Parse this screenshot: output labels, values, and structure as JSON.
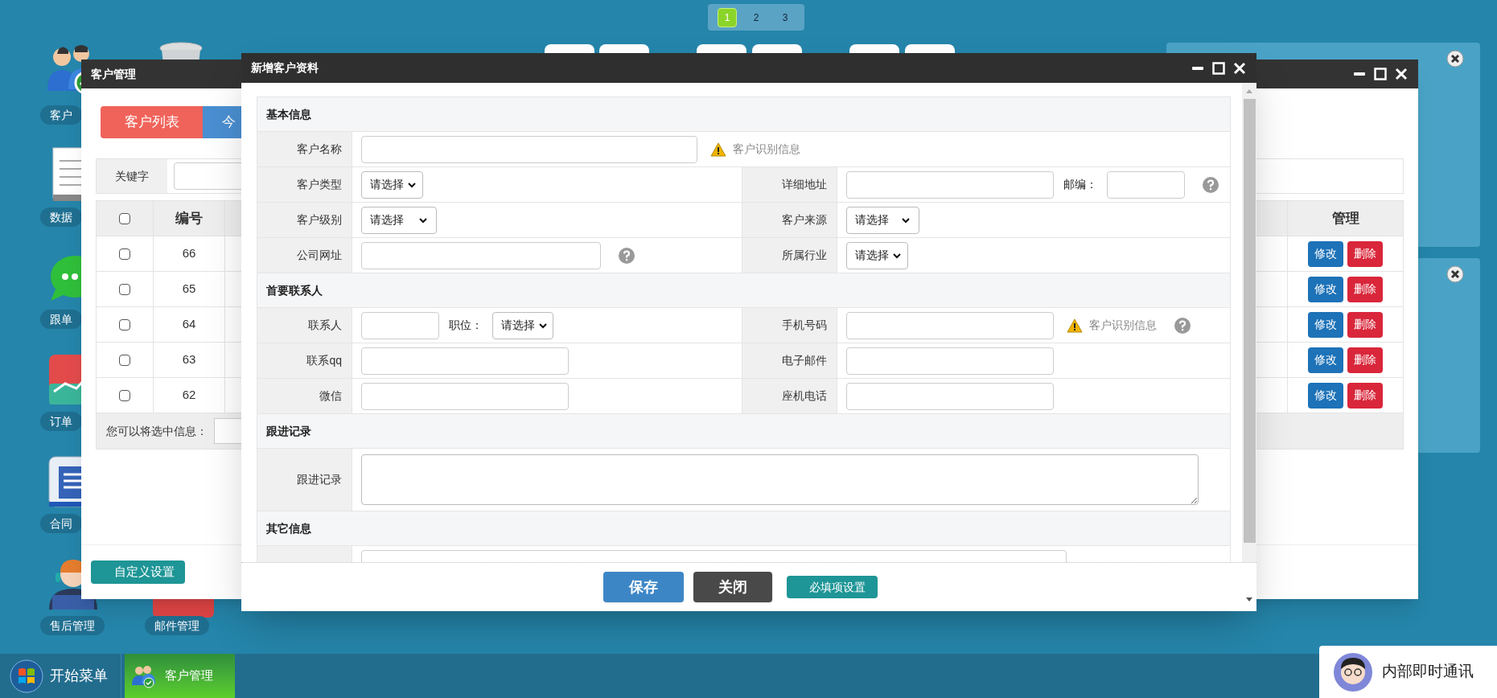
{
  "pager": [
    {
      "label": "1",
      "selected": true
    },
    {
      "label": "2",
      "selected": false
    },
    {
      "label": "3",
      "selected": false
    }
  ],
  "desktop_icons": [
    {
      "kind": "users",
      "label": "客户"
    },
    {
      "kind": "document",
      "label": "数据"
    },
    {
      "kind": "chat",
      "label": "跟单"
    },
    {
      "kind": "chart",
      "label": "订单"
    },
    {
      "kind": "contract",
      "label": "合同"
    },
    {
      "kind": "support",
      "label": "售后管理"
    },
    {
      "kind": "trash"
    },
    {
      "kind": "mail",
      "label": "邮件管理"
    }
  ],
  "customer_window": {
    "title": "客户管理",
    "tabs": [
      {
        "label": "客户列表",
        "selected": true
      },
      {
        "label": "今",
        "selected": false
      }
    ],
    "search_label": "关键字",
    "select_all_checked": false,
    "columns": [
      "编号",
      "管理"
    ],
    "rows": [
      {
        "checked": false,
        "number": "66",
        "actions": [
          "修改",
          "删除"
        ]
      },
      {
        "checked": false,
        "number": "65",
        "actions": [
          "修改",
          "删除"
        ]
      },
      {
        "checked": false,
        "number": "64",
        "actions": [
          "修改",
          "删除"
        ]
      },
      {
        "checked": false,
        "number": "63",
        "actions": [
          "修改",
          "删除"
        ]
      },
      {
        "checked": false,
        "number": "62",
        "actions": [
          "修改",
          "删除"
        ]
      }
    ],
    "bulk_label": "您可以将选中信息：",
    "settings_button": "自定义设置"
  },
  "form_window": {
    "title": "新增客户资料",
    "sections": [
      {
        "title": "基本信息",
        "rows": [
          {
            "kind": "wide",
            "left": {
              "label": "客户名称",
              "controls": [
                {
                  "kind": "input"
                },
                {
                  "kind": "hint",
                  "text": "客户识别信息"
                }
              ]
            }
          },
          {
            "kind": "split",
            "left": {
              "label": "客户类型",
              "controls": [
                {
                  "kind": "select",
                  "value": "请选择"
                }
              ]
            },
            "right": {
              "label": "详细地址",
              "controls": [
                {
                  "kind": "input"
                },
                {
                  "kind": "text",
                  "text": "邮编："
                },
                {
                  "kind": "input"
                },
                {
                  "kind": "help"
                }
              ]
            }
          },
          {
            "kind": "split",
            "left": {
              "label": "客户级别",
              "controls": [
                {
                  "kind": "select",
                  "value": "请选择"
                }
              ]
            },
            "right": {
              "label": "客户来源",
              "controls": [
                {
                  "kind": "select",
                  "value": "请选择"
                }
              ]
            }
          },
          {
            "kind": "split",
            "left": {
              "label": "公司网址",
              "controls": [
                {
                  "kind": "input"
                },
                {
                  "kind": "help"
                }
              ]
            },
            "right": {
              "label": "所属行业",
              "controls": [
                {
                  "kind": "select",
                  "value": "请选择"
                }
              ]
            }
          }
        ]
      },
      {
        "title": "首要联系人",
        "rows": [
          {
            "kind": "split",
            "left": {
              "label": "联系人",
              "controls": [
                {
                  "kind": "input"
                },
                {
                  "kind": "text",
                  "text": "职位："
                },
                {
                  "kind": "select",
                  "value": "请选择"
                }
              ]
            },
            "right": {
              "label": "手机号码",
              "controls": [
                {
                  "kind": "input"
                },
                {
                  "kind": "hint",
                  "text": "客户识别信息"
                },
                {
                  "kind": "help"
                }
              ]
            }
          },
          {
            "kind": "split",
            "left": {
              "label": "联系qq",
              "controls": [
                {
                  "kind": "input"
                }
              ]
            },
            "right": {
              "label": "电子邮件",
              "controls": [
                {
                  "kind": "input"
                }
              ]
            }
          },
          {
            "kind": "split",
            "left": {
              "label": "微信",
              "controls": [
                {
                  "kind": "input"
                }
              ]
            },
            "right": {
              "label": "座机电话",
              "controls": [
                {
                  "kind": "input"
                }
              ]
            }
          }
        ]
      },
      {
        "title": "跟进记录",
        "rows": [
          {
            "kind": "tall",
            "left": {
              "label": "跟进记录",
              "controls": [
                {
                  "kind": "textarea"
                }
              ]
            }
          }
        ]
      },
      {
        "title": "其它信息",
        "rows": [
          {
            "kind": "wide",
            "left": {
              "controls": [
                {
                  "kind": "input"
                }
              ]
            }
          }
        ]
      }
    ],
    "buttons": [
      {
        "kind": "primary",
        "label": "保存"
      },
      {
        "kind": "dark",
        "label": "关闭"
      },
      {
        "kind": "teal",
        "label": "必填项设置"
      }
    ]
  },
  "taskbar": {
    "start_label": "开始菜单",
    "tasks": [
      {
        "label": "客户管理",
        "selected": true
      }
    ]
  },
  "chat_widget": {
    "label": "内部即时通讯"
  }
}
